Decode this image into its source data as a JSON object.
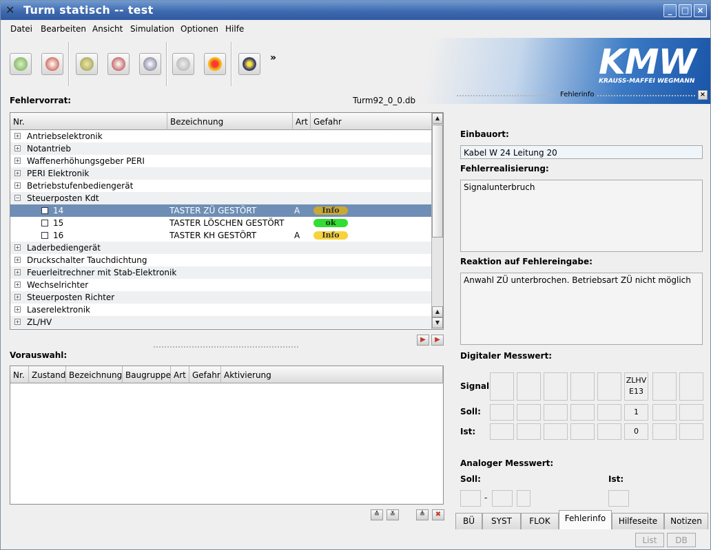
{
  "window": {
    "title": "Turm statisch -- test",
    "controls": [
      "_",
      "□",
      "×"
    ]
  },
  "menu": [
    {
      "label": "Datei"
    },
    {
      "label": "Bearbeiten"
    },
    {
      "label": "Ansicht"
    },
    {
      "label": "Simulation"
    },
    {
      "label": "Optionen"
    },
    {
      "label": "Hilfe"
    }
  ],
  "toolbar": {
    "overflow": "»"
  },
  "logo": {
    "text": "KMW",
    "subtitle": "KRAUSS-MAFFEI WEGMANN"
  },
  "fehlervorrat": {
    "label": "Fehlervorrat:",
    "db_name": "Turm92_0_0.db",
    "columns": [
      "Nr.",
      "Bezeichnung",
      "Art",
      "Gefahr"
    ],
    "groups_top": [
      "Antriebselektronik",
      "Notantrieb",
      "Waffenerhöhungsgeber PERI",
      "PERI Elektronik",
      "Betriebstufenbediengerät"
    ],
    "expanded_group": "Steuerposten Kdt",
    "children": [
      {
        "nr": "14",
        "bezeichnung": "TASTER ZÜ GESTÖRT",
        "art": "A",
        "gefahr": "Info",
        "color": "#c9a833"
      },
      {
        "nr": "15",
        "bezeichnung": "TASTER LÖSCHEN GESTÖRT",
        "art": "",
        "gefahr": "ok",
        "color": "#33dd33"
      },
      {
        "nr": "16",
        "bezeichnung": "TASTER KH GESTÖRT",
        "art": "A",
        "gefahr": "Info",
        "color": "#f7d23a"
      }
    ],
    "groups_bottom": [
      "Laderbediengerät",
      "Druckschalter Tauchdichtung",
      "Feuerleitrechner mit Stab-Elektronik",
      "Wechselrichter",
      "Steuerposten Richter",
      "Laserelektronik",
      "ZL/HV"
    ]
  },
  "vorauswahl": {
    "label": "Vorauswahl:",
    "columns": [
      "Nr.",
      "Zustand",
      "Bezeichnung",
      "Baugruppe",
      "Art",
      "Gefahr",
      "Aktivierung"
    ]
  },
  "fehlerinfo": {
    "panel_title": "Fehlerinfo",
    "einbauort_label": "Einbauort:",
    "einbauort": "Kabel W 24 Leitung 20",
    "realisierung_label": "Fehlerrealisierung:",
    "realisierung": "Signalunterbruch",
    "reaktion_label": "Reaktion auf Fehlereingabe:",
    "reaktion": "Anwahl ZÜ unterbrochen. Betriebsart ZÜ nicht möglich",
    "digital_label": "Digitaler Messwert:",
    "signal_label": "Signal:",
    "soll_label": "Soll:",
    "ist_label": "Ist:",
    "signal_line1": "ZLHV",
    "signal_line2": "E13",
    "soll_value": "1",
    "ist_value": "0",
    "analog_label": "Analoger Messwert:",
    "analog_soll_label": "Soll:",
    "analog_ist_label": "Ist:",
    "dash": "-"
  },
  "tabs": [
    {
      "label": "BÜ"
    },
    {
      "label": "SYST"
    },
    {
      "label": "FLOK"
    },
    {
      "label": "Fehlerinfo"
    },
    {
      "label": "Hilfeseite"
    },
    {
      "label": "Notizen"
    }
  ],
  "bottom_buttons": {
    "list": "List",
    "db": "DB"
  },
  "colors": {
    "selected_row": "#6e8eb5",
    "title_bar": "#3f6ab0",
    "logo_blue": "#1a55a8"
  }
}
